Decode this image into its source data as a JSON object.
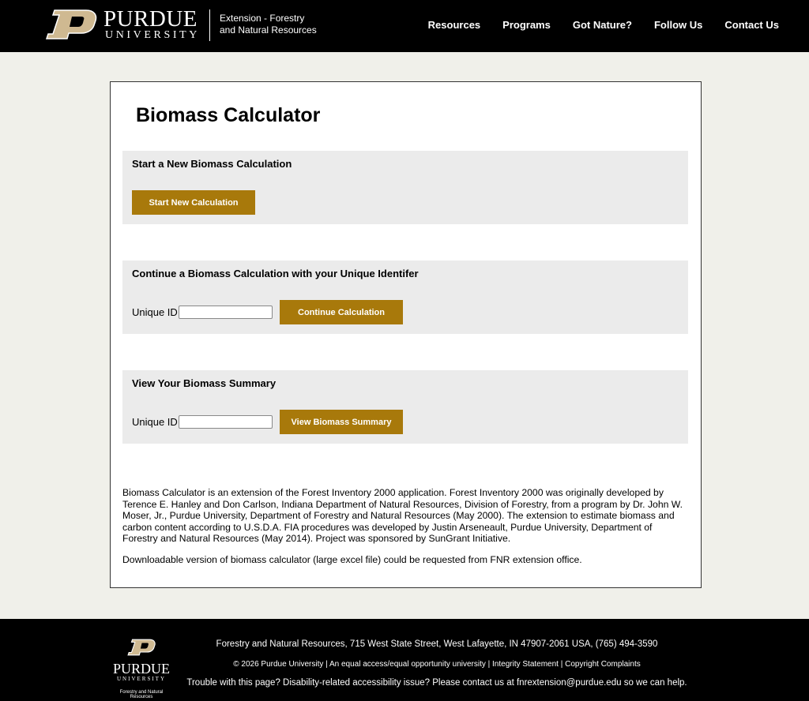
{
  "header": {
    "brand_name": "PURDUE",
    "brand_sub": "UNIVERSITY",
    "brand_mark": "P",
    "unit_line1": "Extension - Forestry",
    "unit_line2": "and Natural Resources",
    "nav": [
      "Resources",
      "Programs",
      "Got Nature?",
      "Follow Us",
      "Contact Us"
    ]
  },
  "main": {
    "title": "Biomass Calculator",
    "new_calc": {
      "heading": "Start a New Biomass Calculation",
      "button": "Start New Calculation"
    },
    "continue_calc": {
      "heading": "Continue a Biomass Calculation with your Unique Identifer",
      "label": "Unique ID",
      "value": "",
      "button": "Continue Calculation"
    },
    "summary": {
      "heading": "View Your Biomass Summary",
      "label": "Unique ID",
      "value": "",
      "button": "View Biomass Summary"
    },
    "description": "Biomass Calculator is an extension of the Forest Inventory 2000 application. Forest Inventory 2000 was originally developed by Terence E. Hanley and Don Carlson, Indiana Department of Natural Resources, Division of Forestry, from a program by Dr. John W. Moser, Jr., Purdue University, Department of Forestry and Natural Resources (May 2000). The extension to estimate biomass and carbon content according to U.S.D.A. FIA procedures was developed by Justin Arseneault, Purdue University, Department of Forestry and Natural Resources (May 2014). Project was sponsored by SunGrant Initiative.",
    "download_note": "Downloadable version of biomass calculator (large excel file) could be requested from FNR extension office."
  },
  "footer": {
    "logo_name": "PURDUE",
    "logo_sub": "UNIVERSITY",
    "logo_dept": "Forestry and Natural Resources",
    "address": "Forestry and Natural Resources, 715 West State Street, West Lafayette, IN 47907-2061 USA, (765) 494-3590",
    "copyright": "© 2026 Purdue University",
    "link1": "An equal access/equal opportunity university",
    "link2": "Integrity Statement",
    "link3": "Copyright Complaints",
    "accessibility": "Trouble with this page? Disability-related accessibility issue? Please contact us at fnrextension@purdue.edu so we can help."
  },
  "colors": {
    "button_gold": "#a8790b",
    "logo_gold": "#cfb991",
    "header_bg": "#000000",
    "page_bg": "#f0f0ea",
    "panel_bg": "#ebebeb"
  }
}
